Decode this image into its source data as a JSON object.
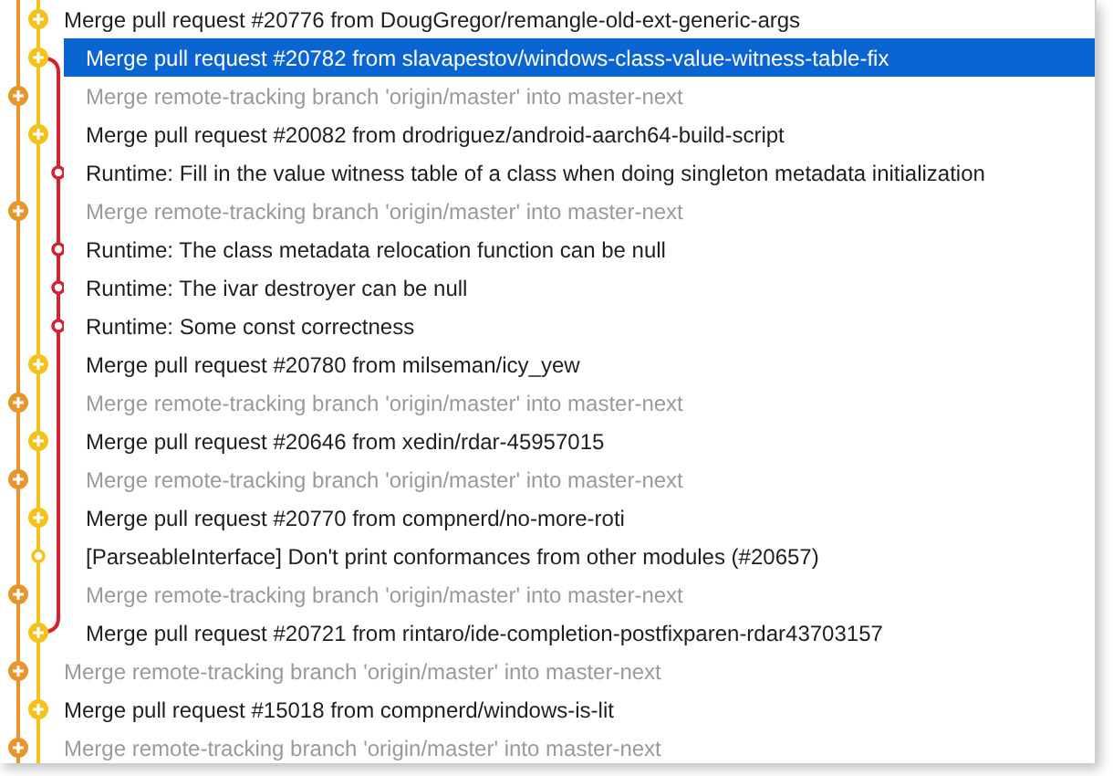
{
  "lanes": [
    {
      "color": "#e8952c"
    },
    {
      "color": "#f5c21b"
    },
    {
      "color": "#d42230"
    }
  ],
  "commits": [
    {
      "message": "Merge pull request #20776 from DougGregor/remangle-old-ext-generic-args",
      "kind": "merge",
      "color": "#f5c21b",
      "faded": false,
      "selected": false,
      "branch_line": false
    },
    {
      "message": "Merge pull request #20782 from slavapestov/windows-class-value-witness-table-fix",
      "kind": "merge",
      "color": "#f5c21b",
      "faded": false,
      "selected": true,
      "branch_line": true
    },
    {
      "message": "Merge remote-tracking branch 'origin/master' into master-next",
      "kind": "merge",
      "color": "#e8952c",
      "faded": true,
      "selected": false,
      "branch_line": true
    },
    {
      "message": "Merge pull request #20082 from drodriguez/android-aarch64-build-script",
      "kind": "merge",
      "color": "#f5c21b",
      "faded": false,
      "selected": false,
      "branch_line": true
    },
    {
      "message": "Runtime: Fill in the value witness table of a class when doing singleton metadata initialization",
      "kind": "commit",
      "color": "#d42230",
      "faded": false,
      "selected": false,
      "branch_line": true
    },
    {
      "message": "Merge remote-tracking branch 'origin/master' into master-next",
      "kind": "merge",
      "color": "#e8952c",
      "faded": true,
      "selected": false,
      "branch_line": true
    },
    {
      "message": "Runtime: The class metadata relocation function can be null",
      "kind": "commit",
      "color": "#d42230",
      "faded": false,
      "selected": false,
      "branch_line": true
    },
    {
      "message": "Runtime: The ivar destroyer can be null",
      "kind": "commit",
      "color": "#d42230",
      "faded": false,
      "selected": false,
      "branch_line": true
    },
    {
      "message": "Runtime: Some const correctness",
      "kind": "commit",
      "color": "#d42230",
      "faded": false,
      "selected": false,
      "branch_line": true
    },
    {
      "message": "Merge pull request #20780 from milseman/icy_yew",
      "kind": "merge",
      "color": "#f5c21b",
      "faded": false,
      "selected": false,
      "branch_line": true
    },
    {
      "message": "Merge remote-tracking branch 'origin/master' into master-next",
      "kind": "merge",
      "color": "#e8952c",
      "faded": true,
      "selected": false,
      "branch_line": true
    },
    {
      "message": "Merge pull request #20646 from xedin/rdar-45957015",
      "kind": "merge",
      "color": "#f5c21b",
      "faded": false,
      "selected": false,
      "branch_line": true
    },
    {
      "message": "Merge remote-tracking branch 'origin/master' into master-next",
      "kind": "merge",
      "color": "#e8952c",
      "faded": true,
      "selected": false,
      "branch_line": true
    },
    {
      "message": "Merge pull request #20770 from compnerd/no-more-roti",
      "kind": "merge",
      "color": "#f5c21b",
      "faded": false,
      "selected": false,
      "branch_line": true
    },
    {
      "message": "[ParseableInterface] Don't print conformances from other modules (#20657)",
      "kind": "commit",
      "color": "#f5c21b",
      "faded": false,
      "selected": false,
      "branch_line": true
    },
    {
      "message": "Merge remote-tracking branch 'origin/master' into master-next",
      "kind": "merge",
      "color": "#e8952c",
      "faded": true,
      "selected": false,
      "branch_line": true
    },
    {
      "message": "Merge pull request #20721 from rintaro/ide-completion-postfixparen-rdar43703157",
      "kind": "merge",
      "color": "#f5c21b",
      "faded": false,
      "selected": false,
      "branch_line": true
    },
    {
      "message": "Merge remote-tracking branch 'origin/master' into master-next",
      "kind": "merge",
      "color": "#e8952c",
      "faded": true,
      "selected": false,
      "branch_line": false
    },
    {
      "message": "Merge pull request #15018 from compnerd/windows-is-lit",
      "kind": "merge",
      "color": "#f5c21b",
      "faded": false,
      "selected": false,
      "branch_line": false
    },
    {
      "message": "Merge remote-tracking branch 'origin/master' into master-next",
      "kind": "merge",
      "color": "#e8952c",
      "faded": true,
      "selected": false,
      "branch_line": false
    }
  ]
}
